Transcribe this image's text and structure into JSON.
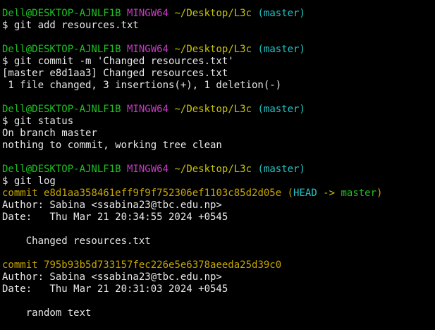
{
  "prompt": {
    "user": "Dell@DESKTOP-AJNLF1B",
    "system": "MINGW64",
    "path": "~/Desktop/L3c",
    "branch": "(master)"
  },
  "blocks": [
    {
      "command": "$ git add resources.txt",
      "output": []
    },
    {
      "command": "$ git commit -m 'Changed resources.txt'",
      "output": [
        "[master e8d1aa3] Changed resources.txt",
        " 1 file changed, 3 insertions(+), 1 deletion(-)"
      ]
    },
    {
      "command": "$ git status",
      "output": [
        "On branch master",
        "nothing to commit, working tree clean"
      ]
    },
    {
      "command": "$ git log",
      "output": []
    }
  ],
  "log": [
    {
      "commit_prefix": "commit ",
      "hash": "e8d1aa358461eff9f9f752306ef1103c85d2d05e",
      "ref_open": " (",
      "ref_head": "HEAD",
      "ref_arrow": " -> ",
      "ref_branch": "master",
      "ref_close": ")",
      "author": "Author: Sabina <ssabina23@tbc.edu.np>",
      "date": "Date:   Thu Mar 21 20:34:55 2024 +0545",
      "message": "    Changed resources.txt"
    },
    {
      "commit_prefix": "commit ",
      "hash": "795b93b5d733157fec226e5e6378aeeda25d39c0",
      "author": "Author: Sabina <ssabina23@tbc.edu.np>",
      "date": "Date:   Thu Mar 21 20:31:03 2024 +0545",
      "message": "    random text"
    }
  ],
  "colors": {
    "background": "#000000",
    "text": "#e8e8e8",
    "user": "#1dc121",
    "system": "#c839c5",
    "path": "#c7c400",
    "branch": "#20c5c6",
    "commit": "#c7a600"
  }
}
